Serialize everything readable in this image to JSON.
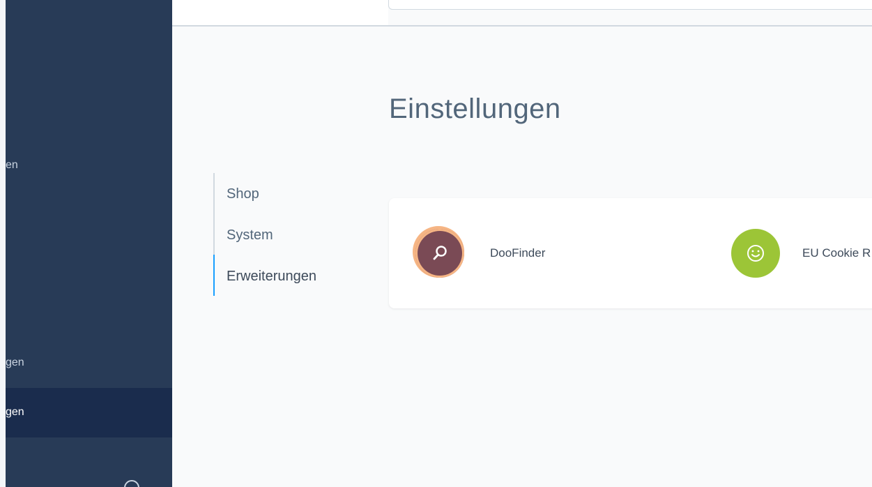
{
  "sidebar": {
    "items": [
      {
        "label": "en",
        "active": false
      },
      {
        "label": "gen",
        "active": false
      },
      {
        "label": "gen",
        "active": true
      }
    ]
  },
  "page": {
    "title": "Einstellungen"
  },
  "tabs": [
    {
      "label": "Shop",
      "active": false
    },
    {
      "label": "System",
      "active": false
    },
    {
      "label": "Erweiterungen",
      "active": true
    }
  ],
  "plugins": [
    {
      "label": "DooFinder",
      "icon": "search-icon",
      "color": "#7a4a55"
    },
    {
      "label": "EU Cookie R",
      "icon": "smiley-icon",
      "color": "#9cc537"
    }
  ],
  "colors": {
    "sidebar_bg": "#283b57",
    "sidebar_active_bg": "#1a2c4d",
    "tab_active_indicator": "#189eff"
  }
}
